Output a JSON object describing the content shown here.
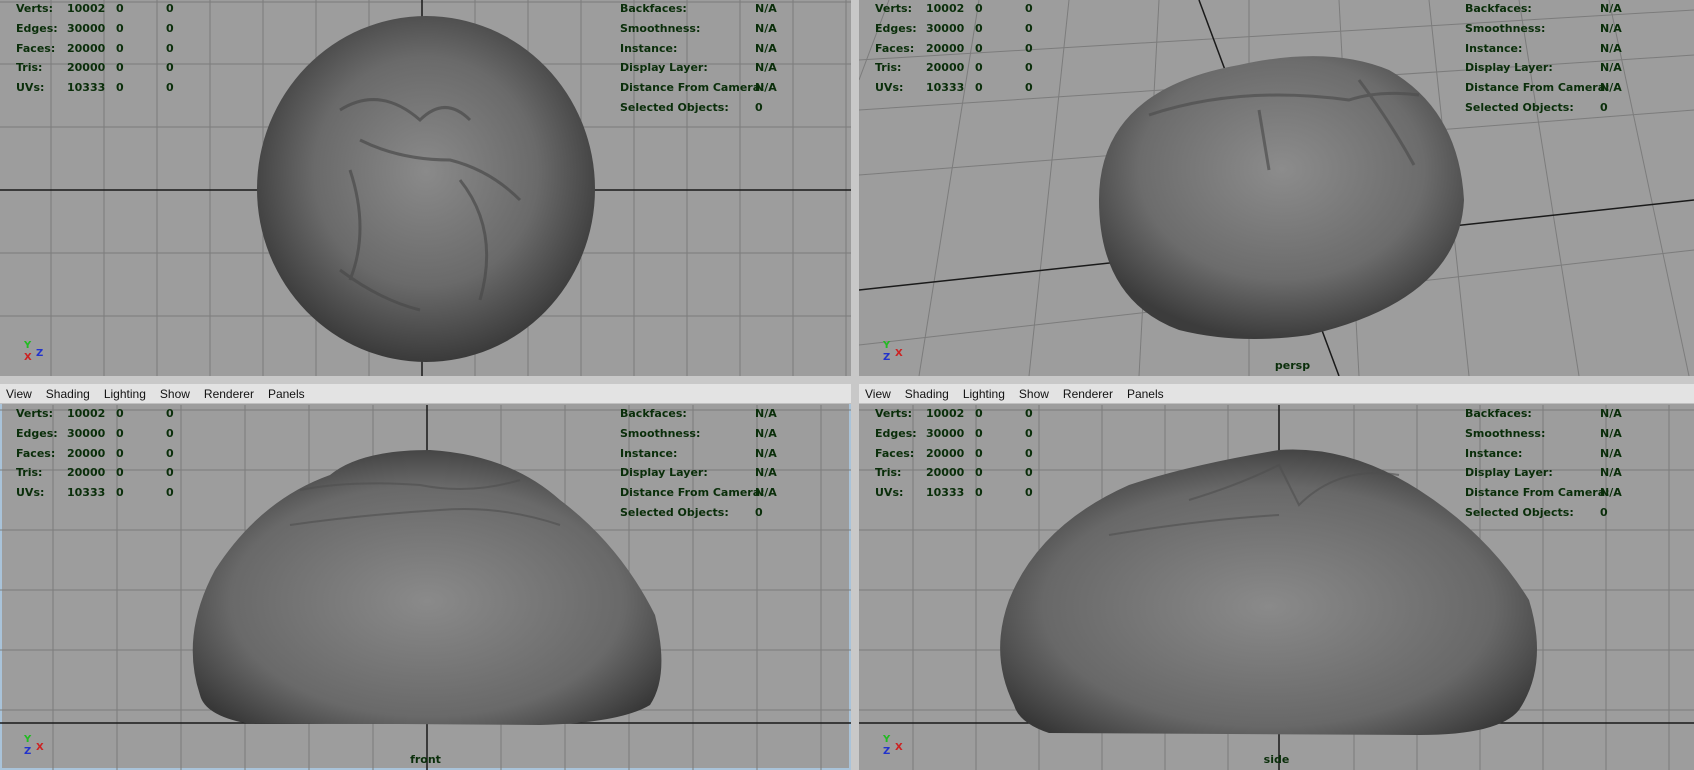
{
  "hud_left": {
    "labels": [
      "Verts:",
      "Edges:",
      "Faces:",
      "Tris:",
      "UVs:"
    ],
    "values": [
      "10002",
      "30000",
      "20000",
      "20000",
      "10333"
    ],
    "zeros": [
      "0",
      "0"
    ]
  },
  "hud_right": {
    "labels": [
      "Backfaces:",
      "Smoothness:",
      "Instance:",
      "Display Layer:",
      "Distance From Camera:",
      "Selected Objects:"
    ],
    "values": [
      "N/A",
      "N/A",
      "N/A",
      "N/A",
      "N/A",
      "0"
    ]
  },
  "viewports": [
    {
      "camera": "top",
      "has_menu": false,
      "selected": false,
      "axes": [
        "Y",
        "X",
        "Z"
      ],
      "label_visible": false
    },
    {
      "camera": "persp",
      "has_menu": false,
      "selected": false,
      "axes": [
        "Y",
        "Z",
        "X"
      ],
      "label_visible": true
    },
    {
      "camera": "front",
      "has_menu": true,
      "selected": true,
      "axes": [
        "Y",
        "Z",
        "X"
      ],
      "label_visible": true
    },
    {
      "camera": "side",
      "has_menu": true,
      "selected": false,
      "axes": [
        "Y",
        "Z",
        "X"
      ],
      "label_visible": true
    }
  ],
  "menu": {
    "items": [
      "View",
      "Shading",
      "Lighting",
      "Show",
      "Renderer",
      "Panels"
    ]
  },
  "colors": {
    "viewport_bg": "#9d9d9d",
    "grid_line": "#7c7c7c",
    "axis_line": "#1a1a1a",
    "hud_text": "#0a2e0a",
    "axis_x": "#cc2222",
    "axis_y": "#22bb22",
    "axis_z": "#2233cc"
  }
}
